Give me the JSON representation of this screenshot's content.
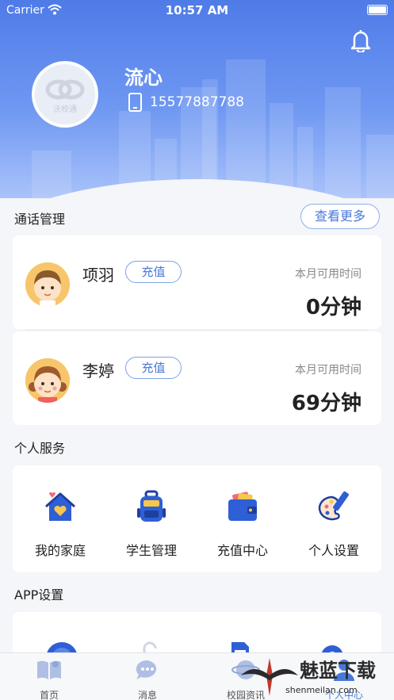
{
  "status_bar": {
    "carrier": "Carrier",
    "time": "10:57 AM"
  },
  "profile": {
    "avatar_logo_text": "沃校通",
    "name": "流心",
    "phone": "15577887788"
  },
  "call_management": {
    "title": "通话管理",
    "more_label": "查看更多",
    "contacts": [
      {
        "name": "项羽",
        "recharge_label": "充值",
        "time_label": "本月可用时间",
        "minutes": "0分钟",
        "avatar": "boy-avatar"
      },
      {
        "name": "李婷",
        "recharge_label": "充值",
        "time_label": "本月可用时间",
        "minutes": "69分钟",
        "avatar": "girl-avatar"
      }
    ]
  },
  "personal_services": {
    "title": "个人服务",
    "items": [
      {
        "label": "我的家庭",
        "icon": "family-house-icon"
      },
      {
        "label": "学生管理",
        "icon": "backpack-icon"
      },
      {
        "label": "充值中心",
        "icon": "wallet-icon"
      },
      {
        "label": "个人设置",
        "icon": "palette-icon"
      }
    ]
  },
  "app_settings": {
    "title": "APP设置"
  },
  "tab_bar": {
    "tabs": [
      {
        "label": "首页",
        "icon": "book-icon"
      },
      {
        "label": "消息",
        "icon": "chat-icon"
      },
      {
        "label": "校园资讯",
        "icon": "news-icon"
      },
      {
        "label": "个人中心",
        "icon": "person-icon"
      }
    ],
    "active": 3
  },
  "watermark": {
    "text": "魅蓝下载",
    "url": "shenmeilan.com"
  },
  "colors": {
    "accent": "#4a78d8",
    "header_top": "#4f7be8",
    "header_bottom": "#a9c2fa"
  }
}
